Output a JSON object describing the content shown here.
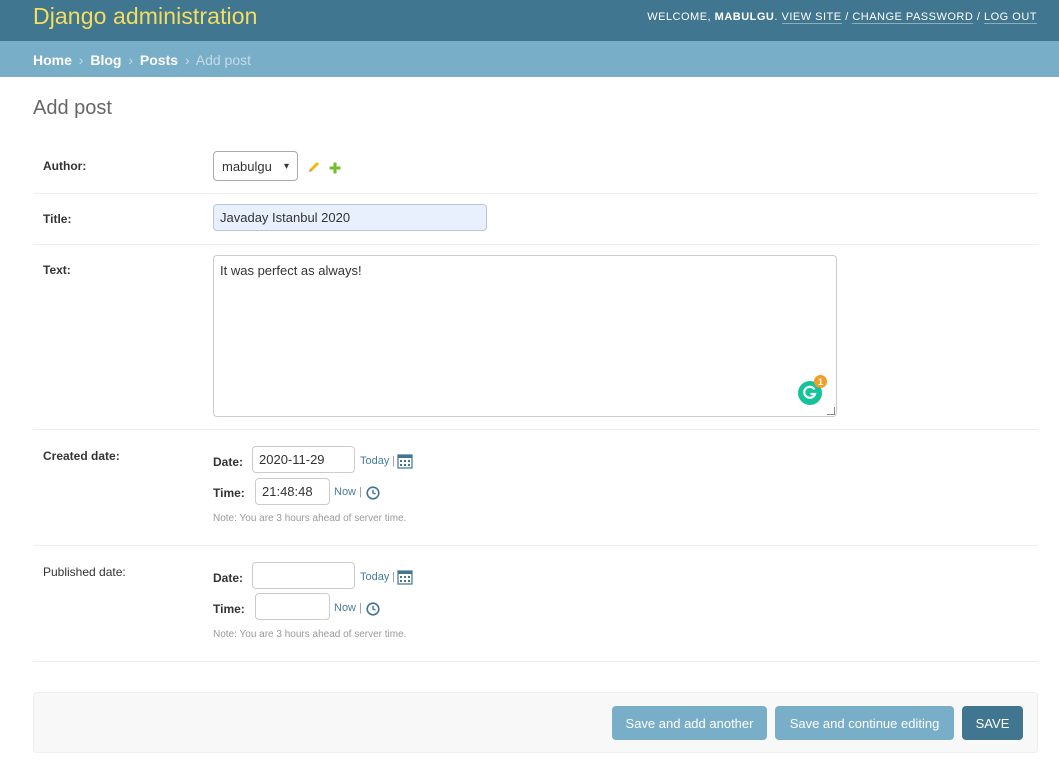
{
  "header": {
    "site_name": "Django administration",
    "welcome": "Welcome,",
    "username": "mabulgu",
    "view_site": "View site",
    "change_password": "Change password",
    "log_out": "Log out",
    "separator": "/"
  },
  "breadcrumbs": {
    "items": [
      "Home",
      "Blog",
      "Posts"
    ],
    "current": "Add post",
    "separator": "›"
  },
  "page": {
    "title": "Add post"
  },
  "form": {
    "author": {
      "label": "Author:",
      "value": "mabulgu"
    },
    "title": {
      "label": "Title:",
      "value": "Javaday Istanbul 2020"
    },
    "text": {
      "label": "Text:",
      "value": "It was perfect as always!",
      "grammarly_badge": "1"
    },
    "created_date": {
      "label": "Created date:",
      "date_label": "Date:",
      "date_value": "2020-11-29",
      "today_link": "Today",
      "time_label": "Time:",
      "time_value": "21:48:48",
      "now_link": "Now",
      "note": "Note: You are 3 hours ahead of server time.",
      "pipe": "|"
    },
    "published_date": {
      "label": "Published date:",
      "date_label": "Date:",
      "date_value": "",
      "today_link": "Today",
      "time_label": "Time:",
      "time_value": "",
      "now_link": "Now",
      "note": "Note: You are 3 hours ahead of server time.",
      "pipe": "|"
    }
  },
  "actions": {
    "save_add_another": "Save and add another",
    "save_continue": "Save and continue editing",
    "save": "Save"
  },
  "icons": {
    "edit": "pencil-icon",
    "add": "plus-icon",
    "calendar": "calendar-icon",
    "clock": "clock-icon",
    "grammarly": "grammarly-icon"
  },
  "colors": {
    "header_bg": "#417690",
    "branding": "#f5dd5d",
    "breadcrumbs_bg": "#79aec8",
    "link": "#447e9b",
    "title_input_bg": "#e8f0fe"
  }
}
